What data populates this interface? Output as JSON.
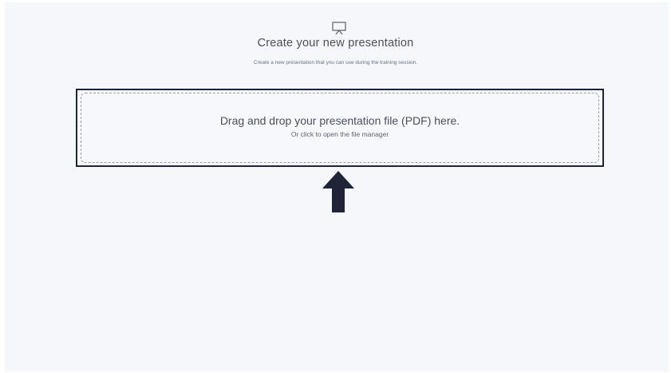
{
  "header": {
    "icon": "presentation-board-icon",
    "title": "Create your new presentation",
    "subtitle": "Create a new presentation that you can use during the training session."
  },
  "dropzone": {
    "title": "Drag and drop your presentation file (PDF) here.",
    "subtitle": "Or click to open the file manager",
    "border_color": "#1f2438"
  },
  "annotation": {
    "icon": "up-arrow-icon",
    "color": "#1f2438"
  }
}
